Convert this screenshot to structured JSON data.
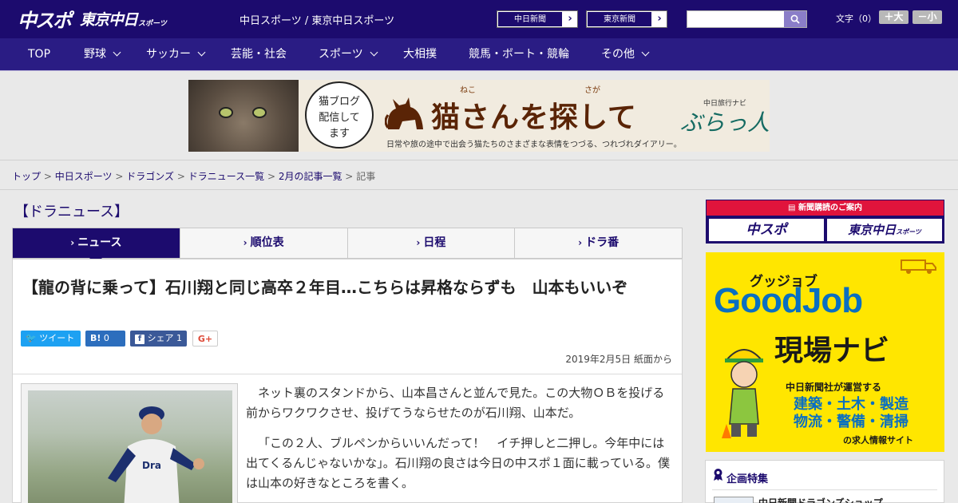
{
  "header": {
    "logo_main": "中スポ",
    "logo_sub": "東京中日",
    "logo_sub_small": "スポーツ",
    "site_title": "中日スポーツ / 東京中日スポーツ",
    "paper_links": [
      "中日新聞",
      "東京新聞"
    ],
    "search_placeholder": "",
    "font_size_label": "文字（0）",
    "font_bigger": "＋大",
    "font_smaller": "－小"
  },
  "nav": {
    "items": [
      {
        "label": "TOP",
        "has_dropdown": false
      },
      {
        "label": "野球",
        "has_dropdown": true
      },
      {
        "label": "サッカー",
        "has_dropdown": true
      },
      {
        "label": "芸能・社会",
        "has_dropdown": false
      },
      {
        "label": "スポーツ",
        "has_dropdown": true
      },
      {
        "label": "大相撲",
        "has_dropdown": false
      },
      {
        "label": "競馬・ボート・競輪",
        "has_dropdown": false
      },
      {
        "label": "その他",
        "has_dropdown": true
      }
    ]
  },
  "banner": {
    "bubble_lines": [
      "猫ブログ",
      "配信して",
      "ます"
    ],
    "ruby_1": "ねこ",
    "ruby_2": "さが",
    "title": "猫さんを探して",
    "subtitle": "日常や旅の途中で出会う猫たちのさまざまな表情をつづる、つれづれダイアリー。",
    "brand_small": "中日旅行ナビ",
    "brand": "ぶらっ人"
  },
  "breadcrumb": {
    "items": [
      "トップ",
      "中日スポーツ",
      "ドラゴンズ",
      "ドラニュース一覧",
      "2月の記事一覧"
    ],
    "separator": ">",
    "current": "記事"
  },
  "section": {
    "title": "【ドラニュース】"
  },
  "tabs": {
    "items": [
      "ニュース",
      "順位表",
      "日程",
      "ドラ番"
    ],
    "active_index": 0
  },
  "article": {
    "headline": "【龍の背に乗って】石川翔と同じ高卒２年目…こちらは昇格ならずも　山本もいいぞ",
    "share": {
      "tweet": "ツイート",
      "hatena": "B!",
      "hatena_count": "0",
      "facebook": "シェア",
      "facebook_count": "1",
      "gplus": "G+"
    },
    "dateline": "2019年2月5日 紙面から",
    "paragraphs": [
      "ネット裏のスタンドから、山本昌さんと並んで見た。この大物ＯＢを投げる前からワクワクさせ、投げてうならせたのが石川翔、山本だ。",
      "「この２人、ブルペンからいいんだって！　イチ押しと二押し。今年中には出てくるんじゃないかな」。石川翔の良さは今日の中スポ１面に載っている。僕は山本の好きなところを書く。"
    ]
  },
  "sidebar": {
    "subscribe_header": "新聞購読のご案内",
    "subscribe_buttons": [
      "中スポ",
      "東京中日"
    ],
    "subscribe_button_small": "スポーツ",
    "goodjob": {
      "kana": "グッジョブ",
      "title": "GoodJob",
      "navi": "現場ナビ",
      "line1": "中日新聞社が運営する",
      "line2": "建築・土木・製造",
      "line3": "物流・警備・清掃",
      "line4": "の求人情報サイト"
    },
    "feature_title": "企画特集",
    "feature_item": "中日新聞ドラゴンズショップ"
  },
  "colors": {
    "brand_navy": "#1c0b6e",
    "nav_bg": "#2a1c84",
    "accent_red": "#e0143c",
    "ad_yellow": "#ffe600",
    "ad_blue": "#0a6fc1",
    "twitter": "#1da1f2",
    "hatena": "#2c6ebd",
    "facebook": "#3b5998"
  }
}
